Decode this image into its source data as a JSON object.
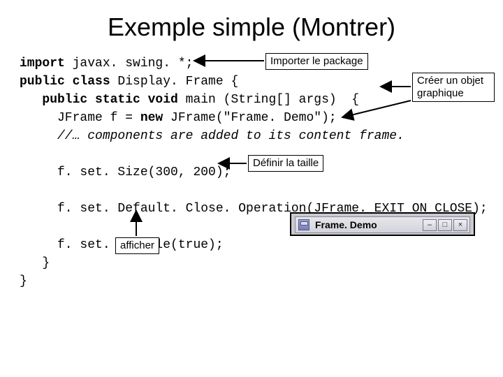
{
  "title": "Exemple simple (Montrer)",
  "labels": {
    "import_pkg": "Importer le package",
    "create_obj": "Créer un objet graphique",
    "set_size": "Définir la taille",
    "show": "afficher"
  },
  "code": {
    "l1a": "import",
    "l1b": " javax. swing. *;",
    "l2a": "public class",
    "l2b": " Display. Frame {",
    "l3a": "   public static void",
    "l3b": " main (String[] args)  {",
    "l4a": "     JFrame f = ",
    "l4b": "new",
    "l4c": " JFrame(\"Frame. Demo\");",
    "l5": "     //… components are added to its content frame.",
    "l6": "     f. set. Size(300, 200);",
    "l7": "     f. set. Default. Close. Operation(JFrame. EXIT_ON_CLOSE);",
    "l8": "     f. set. Visible(true);",
    "l9": "   }",
    "l10": "}"
  },
  "frame": {
    "title": "Frame. Demo",
    "min": "–",
    "max": "□",
    "close": "×"
  }
}
